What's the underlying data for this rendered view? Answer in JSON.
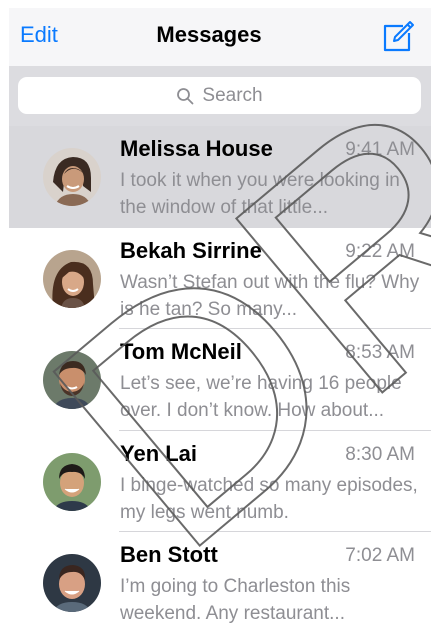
{
  "navbar": {
    "edit_label": "Edit",
    "title": "Messages",
    "compose_icon": "compose-icon"
  },
  "search": {
    "placeholder": "Search",
    "icon": "search-icon"
  },
  "conversations": [
    {
      "name": "Melissa House",
      "time": "9:41 AM",
      "preview": "I took it when you were looking in the window of that little...",
      "selected": true
    },
    {
      "name": "Bekah Sirrine",
      "time": "9:22 AM",
      "preview": "Wasn’t Stefan out with the flu? Why is he tan? So many...",
      "selected": false
    },
    {
      "name": "Tom McNeil",
      "time": "8:53 AM",
      "preview": "Let’s see, we’re having 16 people over. I don’t know. How about...",
      "selected": false
    },
    {
      "name": "Yen Lai",
      "time": "8:30 AM",
      "preview": "I binge-watched so many episodes, my legs went numb.",
      "selected": false
    },
    {
      "name": "Ben Stott",
      "time": "7:02 AM",
      "preview": "I’m going to Charleston this weekend. Any restaurant...",
      "selected": false
    }
  ],
  "watermark": "DR",
  "colors": {
    "accent": "#0a7aff",
    "secondary_text": "#8e8e93",
    "selected_row": "#d8d8dc"
  }
}
